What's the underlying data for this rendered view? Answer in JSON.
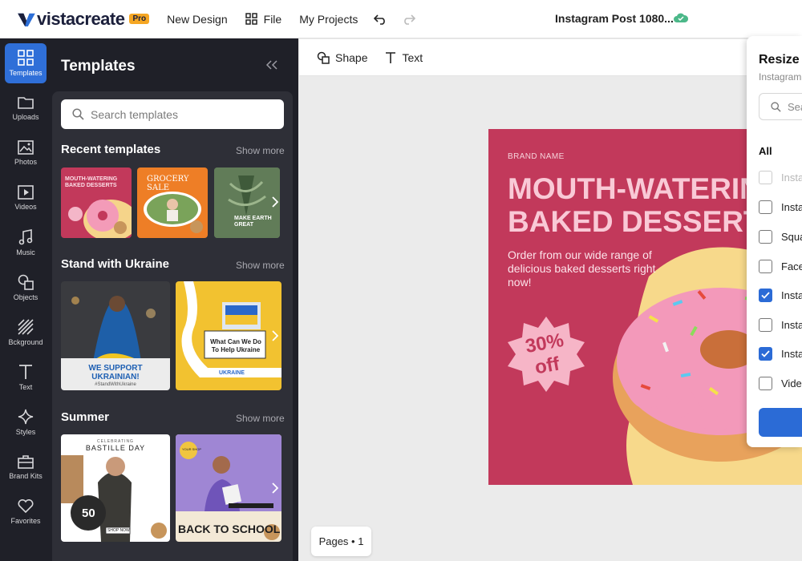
{
  "app": {
    "brand": "vistacreate",
    "pro_badge": "Pro",
    "new_design": "New Design",
    "file": "File",
    "my_projects": "My Projects",
    "doc_title": "Instagram Post 1080..."
  },
  "rail": [
    {
      "label": "Templates",
      "icon": "templates-icon"
    },
    {
      "label": "Uploads",
      "icon": "folder-icon"
    },
    {
      "label": "Photos",
      "icon": "image-icon"
    },
    {
      "label": "Videos",
      "icon": "video-icon"
    },
    {
      "label": "Music",
      "icon": "music-icon"
    },
    {
      "label": "Objects",
      "icon": "objects-icon"
    },
    {
      "label": "Bckground",
      "icon": "background-icon"
    },
    {
      "label": "Text",
      "icon": "text-icon"
    },
    {
      "label": "Styles",
      "icon": "sparkle-icon"
    },
    {
      "label": "Brand Kits",
      "icon": "briefcase-icon"
    },
    {
      "label": "Favorites",
      "icon": "heart-icon"
    }
  ],
  "panel": {
    "title": "Templates",
    "search_placeholder": "Search templates",
    "show_more": "Show more",
    "sections": [
      {
        "title": "Recent templates"
      },
      {
        "title": "Stand with Ukraine"
      },
      {
        "title": "Summer"
      }
    ],
    "thumbs": {
      "t1a": "MOUTH-WATERING",
      "t1b": "BAKED DESSERTS",
      "t2": "GROCERY SALE",
      "t3a": "MAKE EARTH",
      "t3b": "GREAT",
      "u1a": "WE SUPPORT",
      "u1b": "UKRAINIAN!",
      "u1c": "#StandWithUkraine",
      "u2a": "What Can We Do",
      "u2b": "To Help Ukraine",
      "u2c": "UKRAINE",
      "s1a": "CELEBRATING",
      "s1b": "BASTILLE DAY",
      "s1c": "50",
      "s1d": "SHOP NOW",
      "s2a": "YOUR SHOP",
      "s2b": "BACK TO SCHOOL"
    }
  },
  "toolbar": {
    "shape": "Shape",
    "text": "Text"
  },
  "design": {
    "brand_name": "BRAND NAME",
    "headline_1": "MOUTH-WATERING",
    "headline_2": "BAKED DESSERTS",
    "subtitle": "Order from our wide range of delicious baked desserts right now!",
    "badge_1": "30%",
    "badge_2": "off"
  },
  "pages": "Pages • 1",
  "resize": {
    "title": "Resize",
    "subtitle": "Instagram Post",
    "search_placeholder": "Search",
    "all_label": "All",
    "options": [
      {
        "label": "Instagram Post",
        "state": "disabled"
      },
      {
        "label": "Instagram Story",
        "state": "unchecked"
      },
      {
        "label": "Square Video Post",
        "state": "unchecked"
      },
      {
        "label": "Facebook Post",
        "state": "unchecked"
      },
      {
        "label": "Instagram Reel",
        "state": "checked"
      },
      {
        "label": "Instagram Highlight",
        "state": "unchecked"
      },
      {
        "label": "Instagram Ad",
        "state": "checked"
      },
      {
        "label": "Video",
        "state": "unchecked"
      }
    ]
  },
  "colors": {
    "accent": "#2f6fd8",
    "dark_bg": "#1f2028",
    "design_bg": "#c2395b"
  }
}
